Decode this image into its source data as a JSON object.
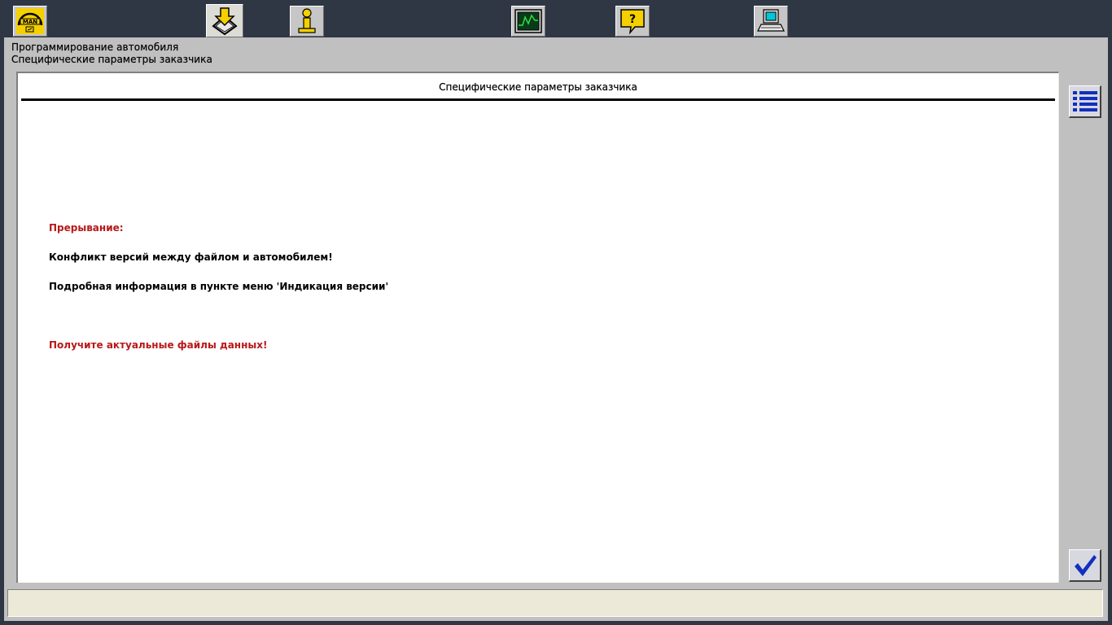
{
  "toolbar": {
    "buttons": [
      {
        "icon": "man-logo-icon",
        "label": "MAN"
      },
      {
        "icon": "download-programming-icon",
        "active": true
      },
      {
        "icon": "info-person-icon"
      },
      {
        "icon": "oscilloscope-icon"
      },
      {
        "icon": "help-question-icon",
        "label": "?"
      },
      {
        "icon": "computer-terminal-icon"
      }
    ]
  },
  "breadcrumb": {
    "line1": "Программирование автомобиля",
    "line2": "Специфические параметры заказчика"
  },
  "content": {
    "title": "Специфические параметры заказчика",
    "interrupt_label": "Прерывание:",
    "conflict_message": "Конфликт версий между файлом и автомобилем!",
    "info_message": "Подробная информация в пункте меню 'Индикация версии'",
    "action_message": "Получите актуальные файлы данных!"
  },
  "side_buttons": {
    "list_icon": "list-icon",
    "confirm_icon": "checkmark-icon"
  },
  "statusbar": {
    "text": ""
  },
  "colors": {
    "background": "#2f3644",
    "panel": "#c0c0c0",
    "error_red": "#b81818",
    "icon_yellow": "#f5d000",
    "icon_blue": "#1030c0"
  }
}
